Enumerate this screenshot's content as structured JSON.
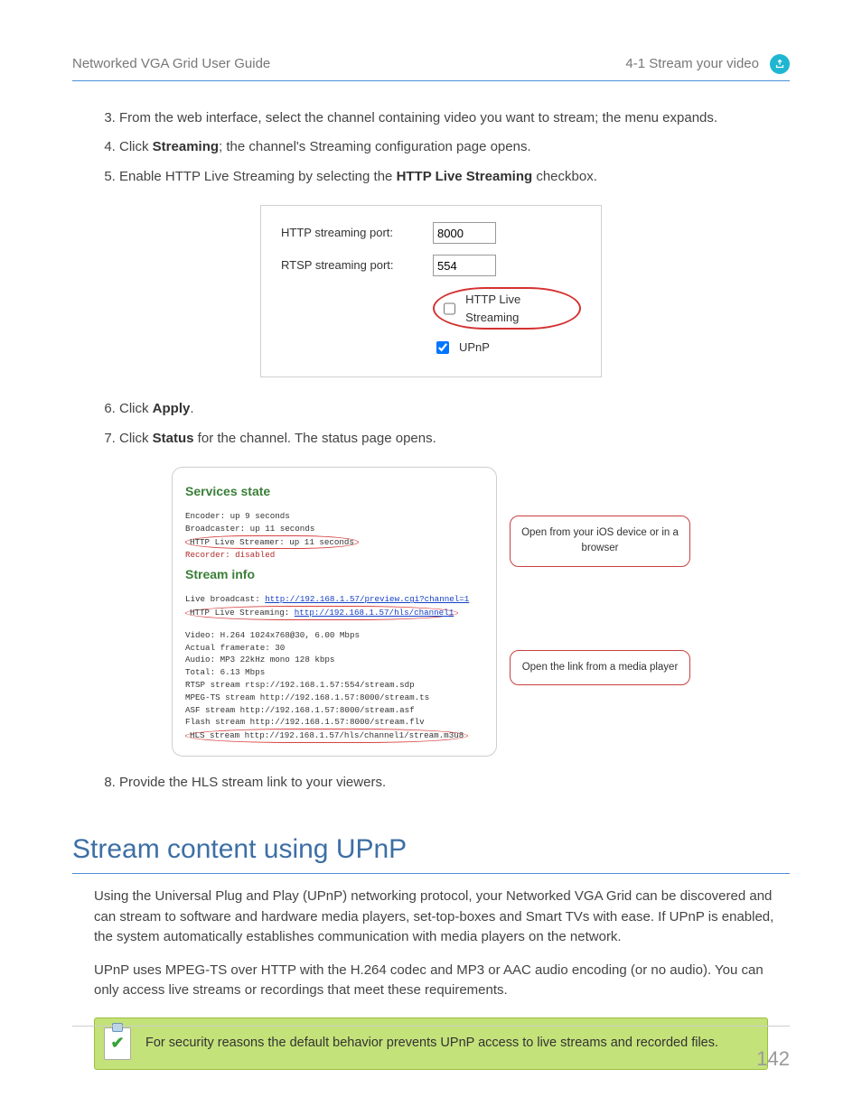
{
  "header": {
    "left": "Networked VGA Grid User Guide",
    "right": "4-1 Stream your video"
  },
  "steps_a": [
    {
      "n": "3.",
      "pre": "From the web interface, select the channel containing video you want to stream; the menu expands.",
      "bold": "",
      "post": ""
    },
    {
      "n": "4.",
      "pre": "Click ",
      "bold": "Streaming",
      "post": "; the channel's Streaming configuration page opens."
    },
    {
      "n": "5.",
      "pre": "Enable HTTP Live Streaming by selecting the ",
      "bold": "HTTP Live Streaming",
      "post": " checkbox."
    }
  ],
  "fig1": {
    "http_port_label": "HTTP streaming port:",
    "http_port_value": "8000",
    "rtsp_port_label": "RTSP streaming port:",
    "rtsp_port_value": "554",
    "hls_label": "HTTP Live Streaming",
    "upnp_label": "UPnP"
  },
  "steps_b": [
    {
      "n": "6.",
      "pre": "Click ",
      "bold": "Apply",
      "post": "."
    },
    {
      "n": "7.",
      "pre": "Click ",
      "bold": "Status",
      "post": " for the channel. The status page opens."
    }
  ],
  "fig2": {
    "services_title": "Services state",
    "svc_lines": [
      "Encoder: up 9 seconds",
      "Broadcaster: up 11 seconds"
    ],
    "svc_hls_line": "HTTP Live Streamer: up 11 seconds",
    "svc_rec_line": "Recorder: disabled",
    "stream_title": "Stream info",
    "live_line_label": "Live broadcast: ",
    "live_line_url": "http://192.168.1.57/preview.cgi?channel=1",
    "hls_line_label": "HTTP Live Streaming: ",
    "hls_line_url": "http://192.168.1.57/hls/channel1",
    "info_lines": [
      "Video: H.264 1024x768@30, 6.00 Mbps",
      "Actual framerate: 30",
      "Audio: MP3 22kHz mono 128 kbps",
      "Total: 6.13 Mbps",
      "RTSP stream rtsp://192.168.1.57:554/stream.sdp",
      "MPEG-TS stream http://192.168.1.57:8000/stream.ts",
      "ASF stream http://192.168.1.57:8000/stream.asf",
      "Flash stream http://192.168.1.57:8000/stream.flv"
    ],
    "hls_stream_line": "HLS stream http://192.168.1.57/hls/channel1/stream.m3u8",
    "bubble1": "Open from your iOS device or in a browser",
    "bubble2": "Open the link from a media player"
  },
  "steps_c": [
    {
      "n": "8.",
      "pre": "Provide the HLS stream link to your viewers.",
      "bold": "",
      "post": ""
    }
  ],
  "section_title": "Stream content using UPnP",
  "para1": "Using the Universal Plug and Play (UPnP) networking protocol, your Networked VGA Grid can be discovered and can stream to software and hardware media players, set-top-boxes and Smart TVs with ease. If UPnP is enabled, the system automatically establishes communication with media players on the network.",
  "para2": "UPnP uses MPEG-TS over HTTP with the H.264 codec and MP3 or AAC audio encoding (or no audio). You can only access live streams or recordings that meet these requirements.",
  "note": "For security reasons the default behavior prevents UPnP access to live streams and recorded files.",
  "page_number": "142"
}
